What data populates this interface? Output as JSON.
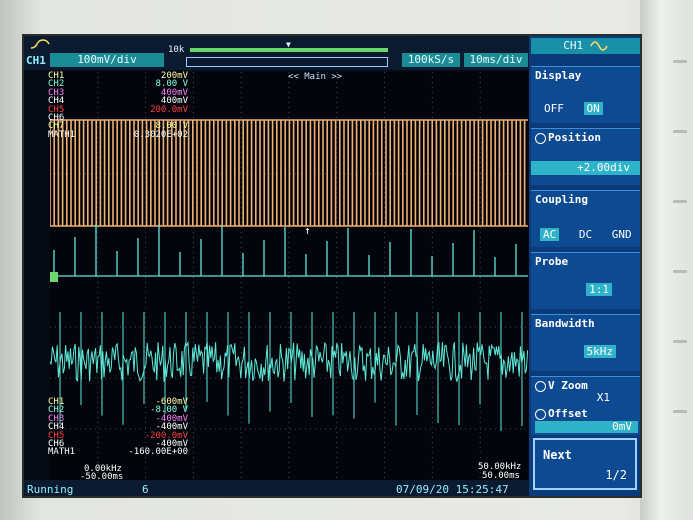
{
  "header": {
    "channel": "CH1",
    "volt_div": "100mV/div",
    "memory_label": "10k",
    "sample_rate": "100kS/s",
    "time_div": "10ms/div",
    "main_label": "<< Main >>"
  },
  "channel_settings_top": [
    {
      "name": "CH1",
      "value": "200mV",
      "color": "#ffffa0"
    },
    {
      "name": "CH2",
      "value": "8.00 V",
      "color": "#80ffe0"
    },
    {
      "name": "CH3",
      "value": "400mV",
      "color": "#ff80ff"
    },
    {
      "name": "CH4",
      "value": "400mV",
      "color": "#ffffff"
    },
    {
      "name": "CH5",
      "value": "200.0mV",
      "color": "#ff4040"
    },
    {
      "name": "CH6",
      "value": "",
      "color": "#ffffff"
    },
    {
      "name": "CH7",
      "value": "8.00 V",
      "color": "#ffffa0"
    },
    {
      "name": "MATH1",
      "value": "0.3020E+02",
      "color": "#ffffff"
    }
  ],
  "channel_settings_bottom": [
    {
      "name": "CH1",
      "value": "-600mV",
      "color": "#ffffa0"
    },
    {
      "name": "CH2",
      "value": "-8.00 V",
      "color": "#80ffe0"
    },
    {
      "name": "CH3",
      "value": "-400mV",
      "color": "#ff80ff"
    },
    {
      "name": "CH4",
      "value": "-400mV",
      "color": "#ffffff"
    },
    {
      "name": "CH5",
      "value": "-200.0mV",
      "color": "#ff4040"
    },
    {
      "name": "CH6",
      "value": "-400mV",
      "color": "#ffffff"
    },
    {
      "name": "MATH1",
      "value": "-160.00E+00",
      "color": "#ffffff"
    }
  ],
  "freq_left": "0.00kHz",
  "time_left": "-50.00ms",
  "freq_right": "50.00kHz",
  "time_right": "50.00ms",
  "status": {
    "state": "Running",
    "count": "6",
    "datetime": "07/09/20 15:25:47"
  },
  "menu": {
    "title": "CH1",
    "display": {
      "label": "Display",
      "options": [
        "OFF",
        "ON"
      ],
      "selected": "ON"
    },
    "position": {
      "label": "Position",
      "value": "+2.00div"
    },
    "coupling": {
      "label": "Coupling",
      "options": [
        "AC",
        "DC",
        "GND"
      ],
      "selected": "AC"
    },
    "probe": {
      "label": "Probe",
      "value": "1:1"
    },
    "bandwidth": {
      "label": "Bandwidth",
      "value": "5kHz"
    },
    "vzoom": {
      "label": "V Zoom",
      "value": "X1"
    },
    "offset": {
      "label": "Offset",
      "value": "0mV"
    },
    "next": {
      "label": "Next",
      "page": "1/2"
    }
  },
  "colors": {
    "trace_orange": "#f0b070",
    "trace_cyan": "#5fe8d8",
    "menu_bg": "#0a3a78",
    "highlight": "#2fb3c8"
  }
}
